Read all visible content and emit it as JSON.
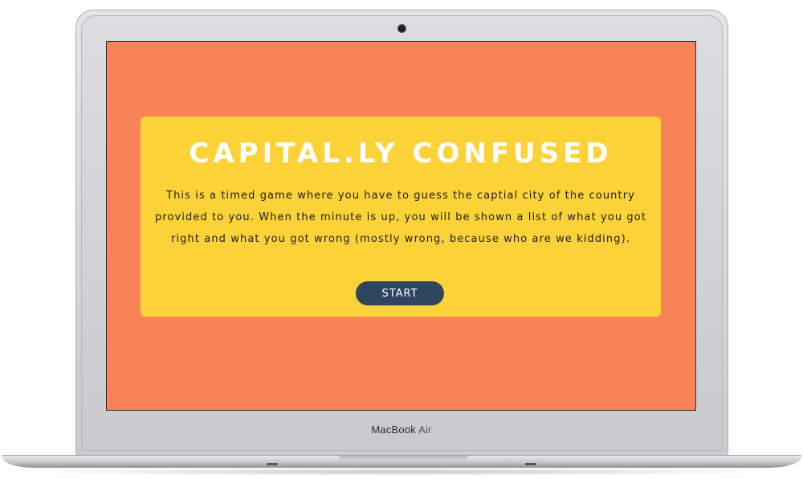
{
  "device": {
    "brand_name": "MacBook",
    "brand_model": "Air"
  },
  "app": {
    "title": "CAPITAL.LY CONFUSED",
    "description": "This is a timed game where you have to guess the captial city of the country provided to you. When the minute is up, you will be shown a list of what you got right and what you got wrong (mostly wrong, because who are we kidding).",
    "start_label": "START"
  },
  "colors": {
    "background": "#f78356",
    "card": "#fbd237",
    "title": "#ffffff",
    "button": "#2e465f"
  }
}
